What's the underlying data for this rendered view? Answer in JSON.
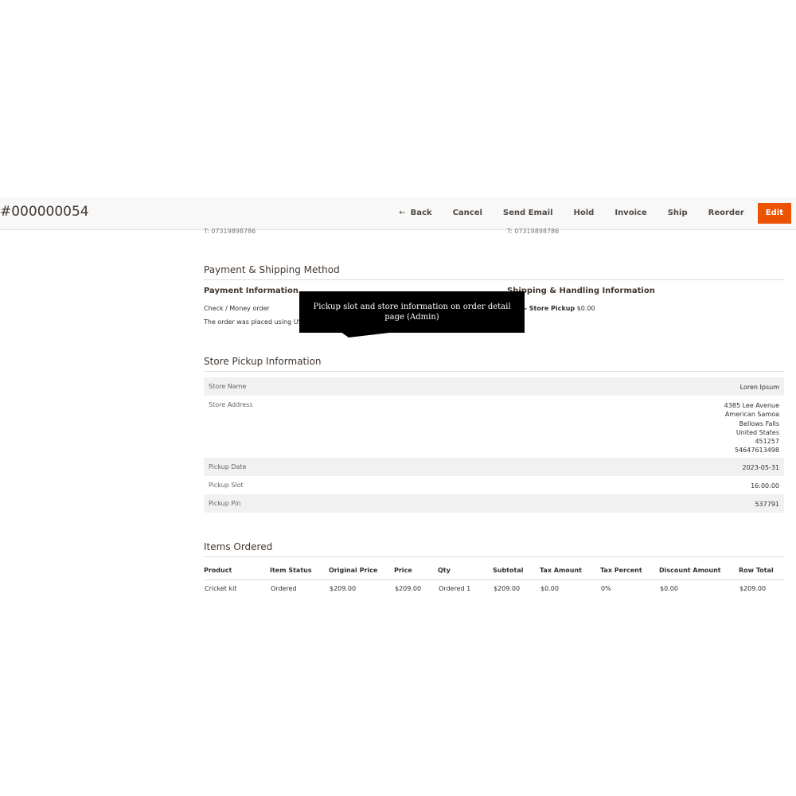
{
  "header": {
    "order_number": "#000000054",
    "buttons": {
      "back": "Back",
      "cancel": "Cancel",
      "send_email": "Send Email",
      "hold": "Hold",
      "invoice": "Invoice",
      "ship": "Ship",
      "reorder": "Reorder",
      "edit": "Edit"
    },
    "accent_color": "#eb5202"
  },
  "address_phones": {
    "billing": "T: 07319898786",
    "shipping": "T: 07319898786"
  },
  "payment_shipping": {
    "title": "Payment & Shipping Method",
    "payment_title": "Payment Information",
    "payment_method": "Check / Money order",
    "payment_note": "The order was placed using USD.",
    "shipping_title": "Shipping & Handling Information",
    "shipping_method": "Way - Store Pickup",
    "shipping_cost": "$0.00"
  },
  "tooltip": {
    "text": "Pickup slot and store information on order detail page (Admin)"
  },
  "store_pickup": {
    "title": "Store Pickup Information",
    "store_name_label": "Store Name",
    "store_name": "Loren Ipsum",
    "store_address_label": "Store Address",
    "store_address_lines": [
      "4385 Lee Avenue",
      "American Samoa",
      "Bellows Falls",
      "United States",
      "451257",
      "54647613498"
    ],
    "pickup_date_label": "Pickup Date",
    "pickup_date": "2023-05-31",
    "pickup_slot_label": "Pickup Slot",
    "pickup_slot": "16:00:00",
    "pickup_pin_label": "Pickup Pin",
    "pickup_pin": "537791"
  },
  "items_ordered": {
    "title": "Items Ordered",
    "columns": [
      "Product",
      "Item Status",
      "Original Price",
      "Price",
      "Qty",
      "Subtotal",
      "Tax Amount",
      "Tax Percent",
      "Discount Amount",
      "Row Total"
    ],
    "rows": [
      [
        "Cricket kit",
        "Ordered",
        "$209.00",
        "$209.00",
        "Ordered 1",
        "$209.00",
        "$0.00",
        "0%",
        "$0.00",
        "$209.00"
      ]
    ]
  }
}
